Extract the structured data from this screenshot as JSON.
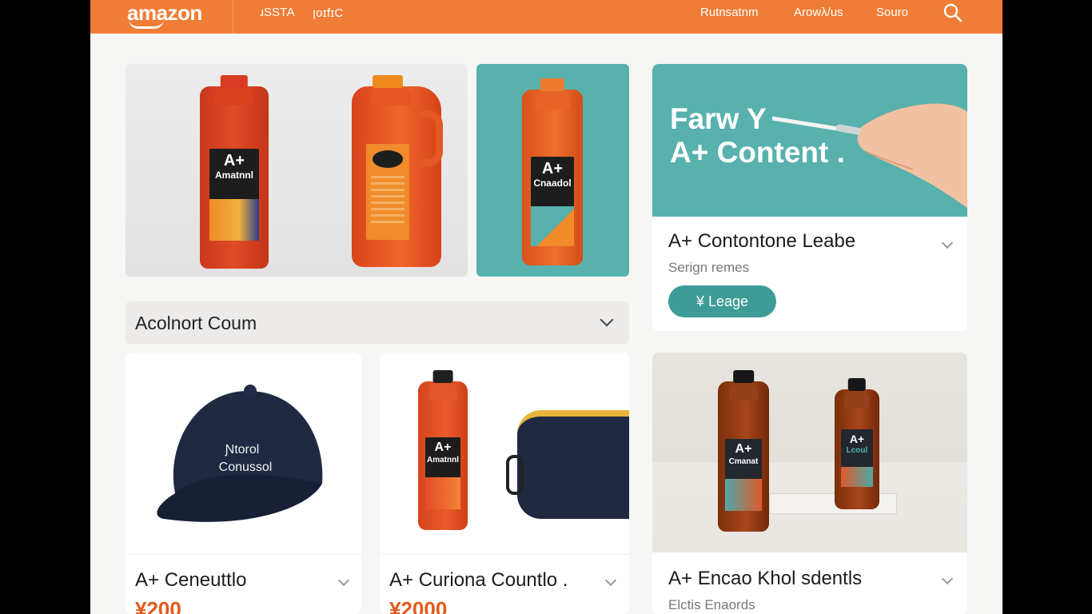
{
  "header": {
    "logo": "amazon",
    "nav_left": [
      "ɹЅЅТА",
      "ꞁоɪfɪC"
    ],
    "nav_right": [
      "Rutnsatnm",
      "Arowλ/us",
      "Souro"
    ],
    "search_icon": "search-icon"
  },
  "hero": {
    "bottle_label_1": "A+",
    "bottle_sub_1": "Amatnnl",
    "bottle_label_3": "A+",
    "bottle_sub_3": "Cnaadol",
    "teal_color": "#58b1ad",
    "accent_color": "#ef7d35"
  },
  "dropdown": {
    "label": "Acolnort Coum"
  },
  "feature_card": {
    "image_text_line1": "Farw Y",
    "image_text_line2": "A+ Content .",
    "title": "A+ Contontone Leabe",
    "subtitle": "Serign remes",
    "button_label": "¥ Leage"
  },
  "products": [
    {
      "image_text_line1": "Ɲtorol",
      "image_text_line2": "Conussol",
      "title": "A+ Ceneuttlo",
      "price": "¥200"
    },
    {
      "bottle_label": "A+",
      "bottle_sub": "Amatnnl",
      "title": "A+ Curiona Countlo .",
      "price": "¥2000"
    },
    {
      "bottle_label_1": "A+",
      "bottle_sub_1": "Cmanat",
      "bottle_label_2": "A+",
      "bottle_sub_2": "Lcoul",
      "title": "A+ Encao Khol sdentls",
      "subtitle": "Elctis Enaords"
    }
  ]
}
